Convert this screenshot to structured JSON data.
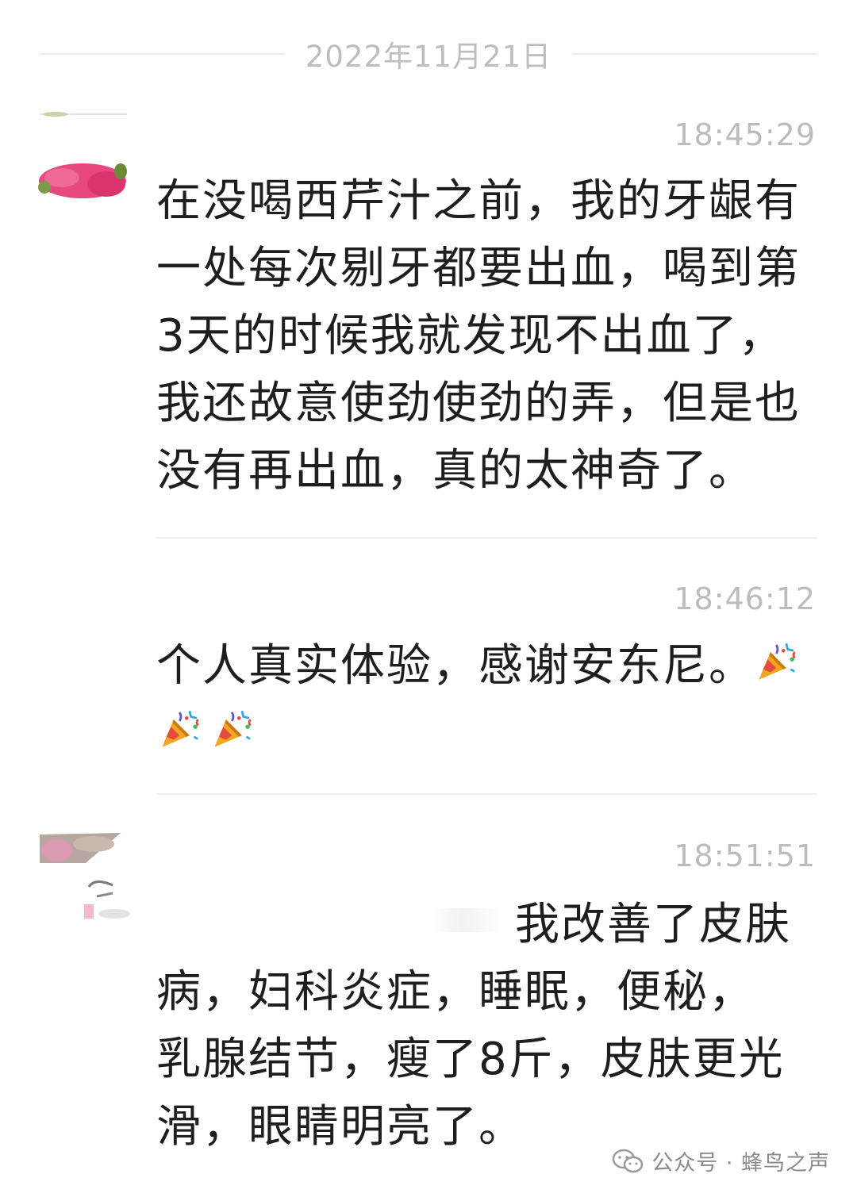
{
  "date_divider": "2022年11月21日",
  "messages": [
    {
      "time": "18:45:29",
      "lines": [
        "在没喝西芹汁之前，我的牙龈有",
        "一处每次剔牙都要出血，喝到第",
        "3天的时候我就发现不出血了，",
        "我还故意使劲使劲的弄，但是也",
        "没有再出血，真的太神奇了。"
      ]
    },
    {
      "time": "18:46:12",
      "line1": "个人真实体验，感谢安东尼。",
      "emoji": "party-popper-icon"
    },
    {
      "time": "18:51:51",
      "first_line_tail": "我改善了皮肤",
      "lines": [
        "病，妇科炎症，睡眠，便秘，",
        "乳腺结节，瘦了8斤，皮肤更光",
        "滑，眼睛明亮了。"
      ]
    }
  ],
  "watermark": {
    "text": "公众号 · 蜂鸟之声"
  },
  "colors": {
    "avatar_pink": "#e8477f",
    "text": "#1e1e1e",
    "timestamp": "#bcbcbc"
  }
}
